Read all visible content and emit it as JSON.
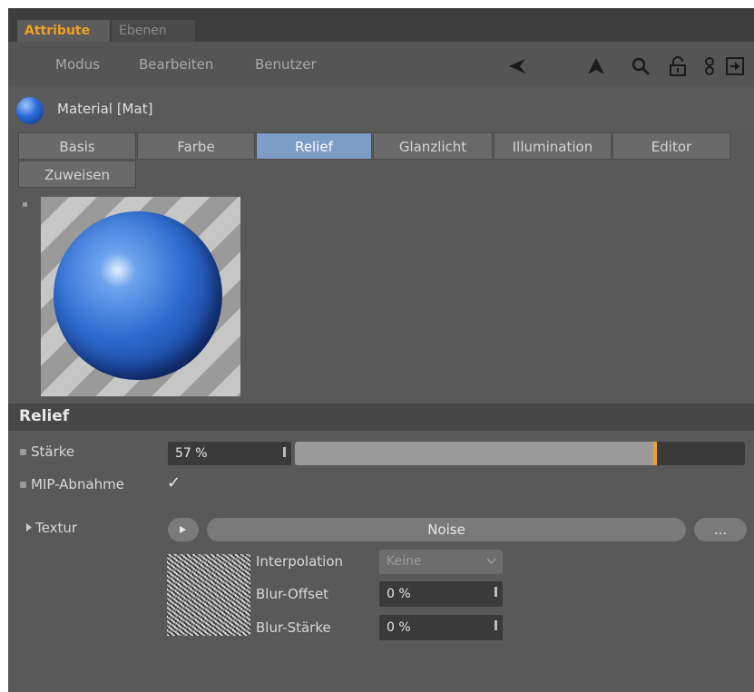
{
  "window_tabs": [
    "Attribute",
    "Ebenen"
  ],
  "menu": [
    "Modus",
    "Bearbeiten",
    "Benutzer"
  ],
  "toolbar_icons": [
    "back-arrow-icon",
    "up-arrow-icon",
    "search-icon",
    "lock-icon",
    "link-icon",
    "new-window-icon"
  ],
  "header": {
    "title": "Material [Mat]",
    "icon": "material-ball-icon"
  },
  "property_tabs": [
    "Basis",
    "Farbe",
    "Relief",
    "Glanzlicht",
    "Illumination",
    "Editor",
    "Zuweisen"
  ],
  "active_tab": "Relief",
  "section": {
    "title": "Relief"
  },
  "staerke": {
    "label": "Stärke",
    "value": "57 %",
    "fraction": 0.57
  },
  "mip": {
    "label": "MIP-Abnahme",
    "checked": true,
    "check_glyph": "✓"
  },
  "textur": {
    "label": "Textur",
    "shader_name": "Noise",
    "more_button": "...",
    "play_icon": "triangle-right-icon"
  },
  "interpolation": {
    "label": "Interpolation",
    "value": "Keine"
  },
  "blur_offset": {
    "label": "Blur-Offset",
    "value": "0 %"
  },
  "blur_staerke": {
    "label": "Blur-Stärke",
    "value": "0 %"
  },
  "colors": {
    "accent": "#f0a020",
    "active_tab": "#7d9cc6",
    "panel": "#595959"
  }
}
